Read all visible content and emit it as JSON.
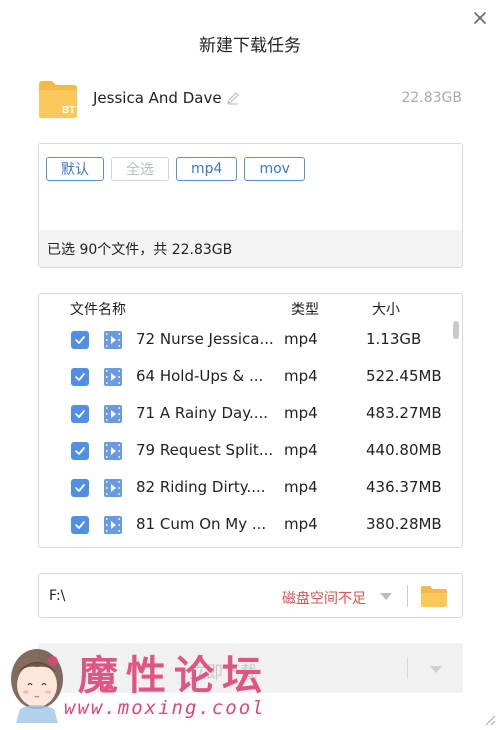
{
  "window": {
    "title": "新建下载任务"
  },
  "torrent": {
    "icon_label": "BT",
    "name": "Jessica And Dave",
    "total_size": "22.83GB"
  },
  "filters": {
    "chips": [
      {
        "label": "默认",
        "enabled": true
      },
      {
        "label": "全选",
        "enabled": false
      },
      {
        "label": "mp4",
        "enabled": true
      },
      {
        "label": "mov",
        "enabled": true
      }
    ],
    "summary": "已选 90个文件，共 22.83GB"
  },
  "file_list": {
    "columns": {
      "name": "文件名称",
      "type": "类型",
      "size": "大小"
    },
    "rows": [
      {
        "name": "72 Nurse Jessica...",
        "type": "mp4",
        "size": "1.13GB",
        "checked": true
      },
      {
        "name": "64 Hold-Ups & ...",
        "type": "mp4",
        "size": "522.45MB",
        "checked": true
      },
      {
        "name": "71 A Rainy Day....",
        "type": "mp4",
        "size": "483.27MB",
        "checked": true
      },
      {
        "name": "79 Request Split...",
        "type": "mp4",
        "size": "440.80MB",
        "checked": true
      },
      {
        "name": "82 Riding Dirty....",
        "type": "mp4",
        "size": "436.37MB",
        "checked": true
      },
      {
        "name": "81 Cum On My ...",
        "type": "mp4",
        "size": "380.28MB",
        "checked": true
      }
    ]
  },
  "save_path": {
    "path": "F:\\",
    "warning": "磁盘空间不足"
  },
  "download_button": {
    "label": "立即下载"
  },
  "watermark": {
    "text": "魔性论坛",
    "url": "www.moxing.cool"
  },
  "colors": {
    "accent": "#4f8fe6",
    "chip_border": "#5b8fd6",
    "warning": "#d9534f",
    "folder": "#f5b94a",
    "watermark": "#e0457a"
  }
}
